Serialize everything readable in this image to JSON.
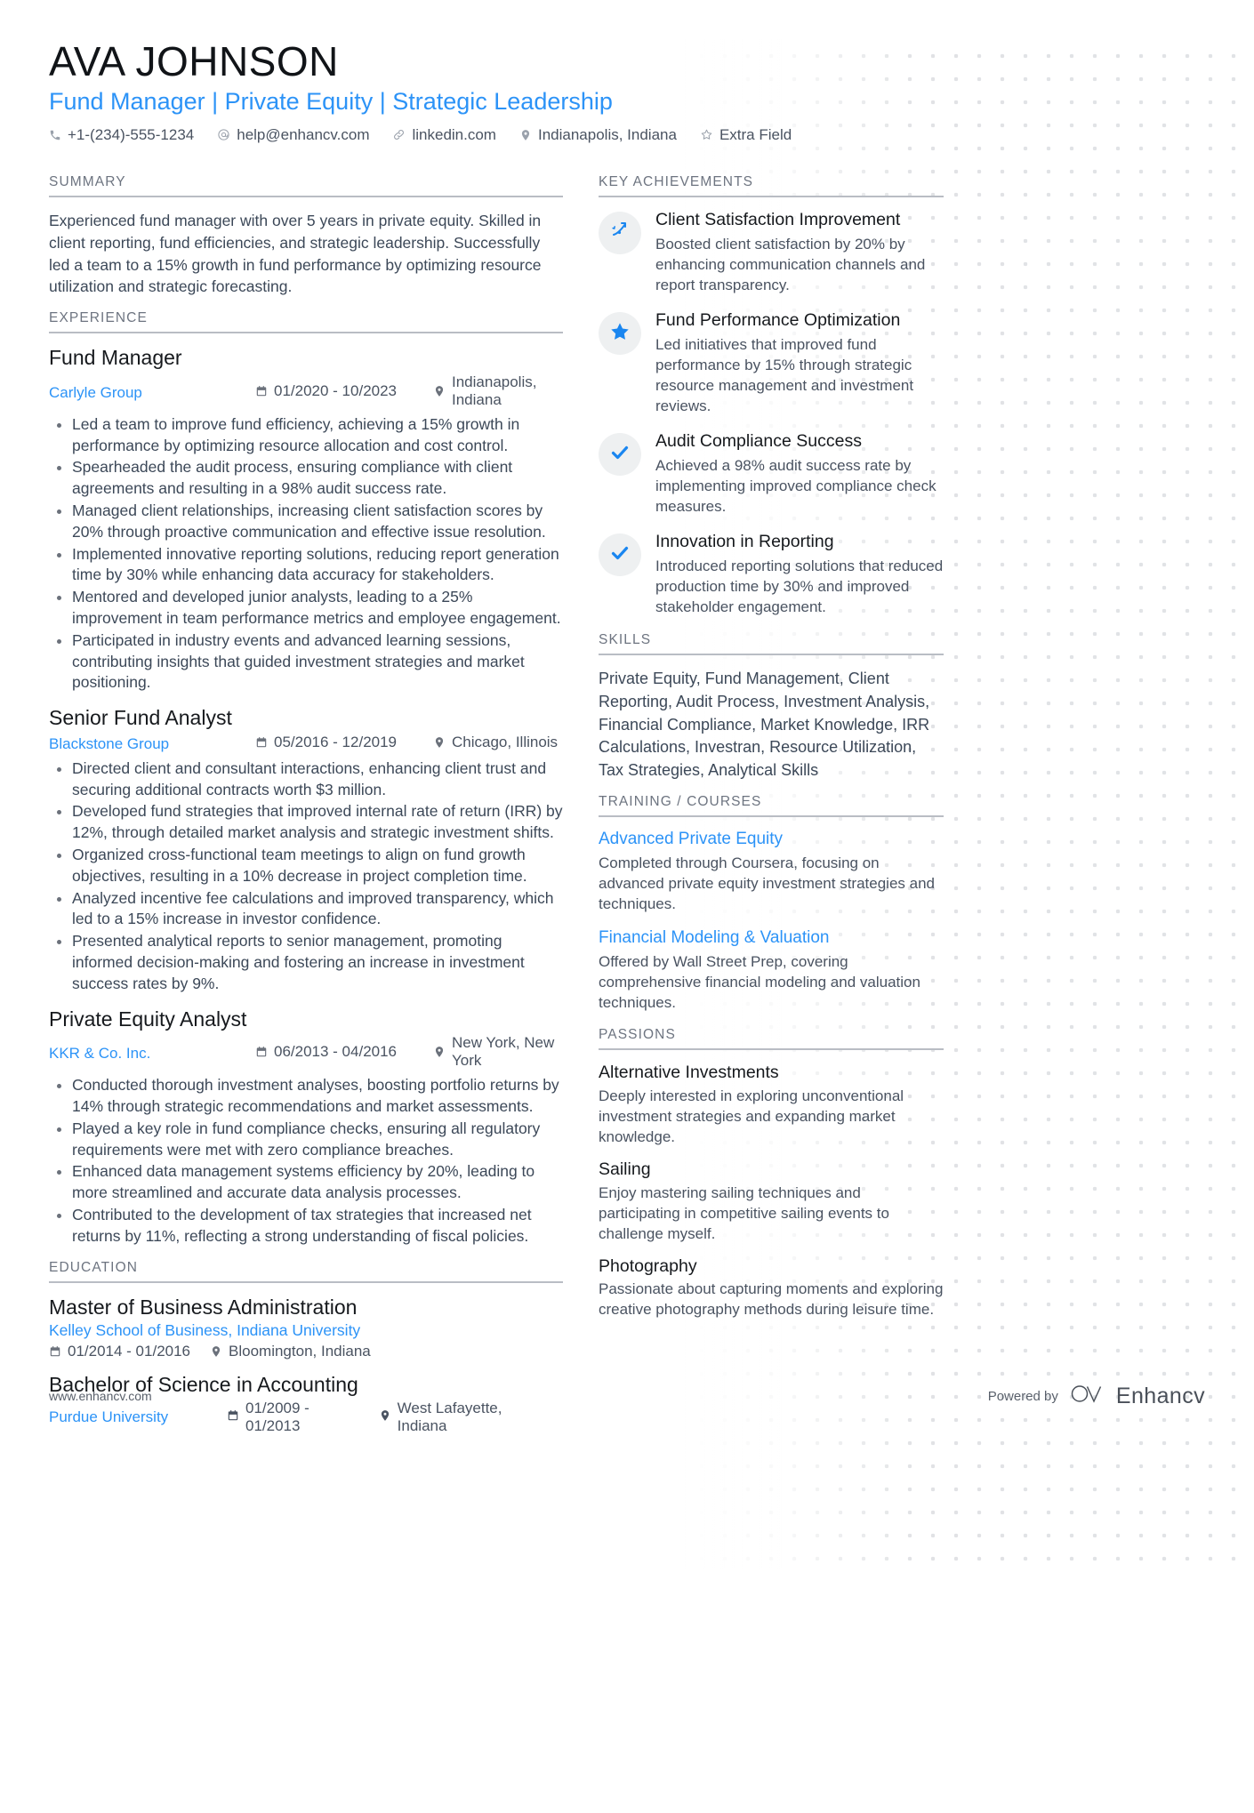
{
  "accent_color": "#2c93f7",
  "header": {
    "name": "AVA JOHNSON",
    "headline": "Fund Manager | Private Equity | Strategic Leadership",
    "contacts": [
      {
        "icon": "phone-icon",
        "text": "+1-(234)-555-1234"
      },
      {
        "icon": "email-icon",
        "text": "help@enhancv.com"
      },
      {
        "icon": "link-icon",
        "text": "linkedin.com"
      },
      {
        "icon": "location-pin-icon",
        "text": "Indianapolis, Indiana"
      },
      {
        "icon": "star-icon",
        "text": "Extra Field"
      }
    ]
  },
  "left": {
    "summary": {
      "title": "SUMMARY",
      "text": "Experienced fund manager with over 5 years in private equity. Skilled in client reporting, fund efficiencies, and strategic leadership. Successfully led a team to a 15% growth in fund performance by optimizing resource utilization and strategic forecasting."
    },
    "experience": {
      "title": "EXPERIENCE",
      "entries": [
        {
          "role": "Fund Manager",
          "company": "Carlyle Group",
          "dates": "01/2020 - 10/2023",
          "location": "Indianapolis, Indiana",
          "bullets": [
            "Led a team to improve fund efficiency, achieving a 15% growth in performance by optimizing resource allocation and cost control.",
            "Spearheaded the audit process, ensuring compliance with client agreements and resulting in a 98% audit success rate.",
            "Managed client relationships, increasing client satisfaction scores by 20% through proactive communication and effective issue resolution.",
            "Implemented innovative reporting solutions, reducing report generation time by 30% while enhancing data accuracy for stakeholders.",
            "Mentored and developed junior analysts, leading to a 25% improvement in team performance metrics and employee engagement.",
            "Participated in industry events and advanced learning sessions, contributing insights that guided investment strategies and market positioning."
          ]
        },
        {
          "role": "Senior Fund Analyst",
          "company": "Blackstone Group",
          "dates": "05/2016 - 12/2019",
          "location": "Chicago, Illinois",
          "bullets": [
            "Directed client and consultant interactions, enhancing client trust and securing additional contracts worth $3 million.",
            "Developed fund strategies that improved internal rate of return (IRR) by 12%, through detailed market analysis and strategic investment shifts.",
            "Organized cross-functional team meetings to align on fund growth objectives, resulting in a 10% decrease in project completion time.",
            "Analyzed incentive fee calculations and improved transparency, which led to a 15% increase in investor confidence.",
            "Presented analytical reports to senior management, promoting informed decision-making and fostering an increase in investment success rates by 9%."
          ]
        },
        {
          "role": "Private Equity Analyst",
          "company": "KKR & Co. Inc.",
          "dates": "06/2013 - 04/2016",
          "location": "New York, New York",
          "bullets": [
            "Conducted thorough investment analyses, boosting portfolio returns by 14% through strategic recommendations and market assessments.",
            "Played a key role in fund compliance checks, ensuring all regulatory requirements were met with zero compliance breaches.",
            "Enhanced data management systems efficiency by 20%, leading to more streamlined and accurate data analysis processes.",
            "Contributed to the development of tax strategies that increased net returns by 11%, reflecting a strong understanding of fiscal policies."
          ]
        }
      ]
    },
    "education": {
      "title": "EDUCATION",
      "entries": [
        {
          "degree": "Master of Business Administration",
          "school": "Kelley School of Business, Indiana University",
          "dates": "01/2014 - 01/2016",
          "location": "Bloomington, Indiana",
          "inline": false
        },
        {
          "degree": "Bachelor of Science in Accounting",
          "school": "Purdue University",
          "dates": "01/2009 - 01/2013",
          "location": "West Lafayette, Indiana",
          "inline": true
        }
      ]
    }
  },
  "right": {
    "achievements": {
      "title": "KEY ACHIEVEMENTS",
      "items": [
        {
          "icon": "trend-arrow-icon",
          "title": "Client Satisfaction Improvement",
          "desc": "Boosted client satisfaction by 20% by enhancing communication channels and report transparency."
        },
        {
          "icon": "star-icon",
          "title": "Fund Performance Optimization",
          "desc": "Led initiatives that improved fund performance by 15% through strategic resource management and investment reviews."
        },
        {
          "icon": "check-icon",
          "title": "Audit Compliance Success",
          "desc": "Achieved a 98% audit success rate by implementing improved compliance check measures."
        },
        {
          "icon": "check-icon",
          "title": "Innovation in Reporting",
          "desc": "Introduced reporting solutions that reduced production time by 30% and improved stakeholder engagement."
        }
      ]
    },
    "skills": {
      "title": "SKILLS",
      "text": "Private Equity, Fund Management, Client Reporting, Audit Process, Investment Analysis, Financial Compliance, Market Knowledge, IRR Calculations, Investran, Resource Utilization, Tax Strategies, Analytical Skills"
    },
    "training": {
      "title": "TRAINING / COURSES",
      "items": [
        {
          "name": "Advanced Private Equity",
          "desc": "Completed through Coursera, focusing on advanced private equity investment strategies and techniques."
        },
        {
          "name": "Financial Modeling & Valuation",
          "desc": "Offered by Wall Street Prep, covering comprehensive financial modeling and valuation techniques."
        }
      ]
    },
    "passions": {
      "title": "PASSIONS",
      "items": [
        {
          "name": "Alternative Investments",
          "desc": "Deeply interested in exploring unconventional investment strategies and expanding market knowledge."
        },
        {
          "name": "Sailing",
          "desc": "Enjoy mastering sailing techniques and participating in competitive sailing events to challenge myself."
        },
        {
          "name": "Photography",
          "desc": "Passionate about capturing moments and exploring creative photography methods during leisure time."
        }
      ]
    }
  },
  "footer": {
    "url": "www.enhancv.com",
    "powered_by": "Powered by",
    "brand": "Enhancv"
  }
}
